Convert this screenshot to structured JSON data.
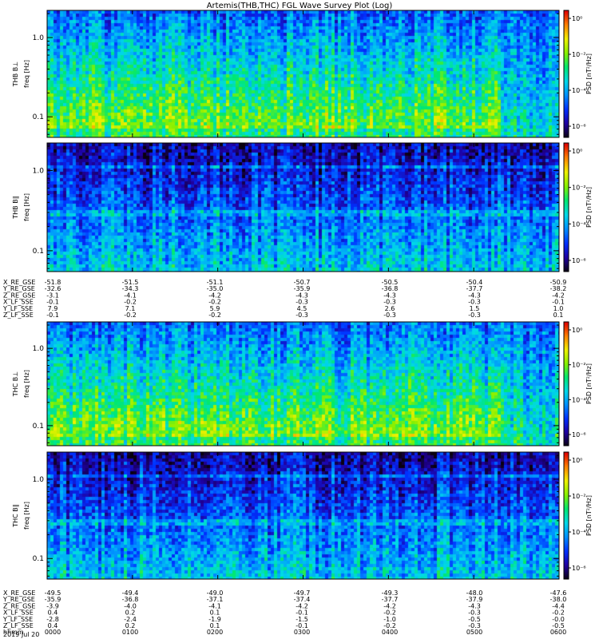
{
  "figure": {
    "title": "Artemis(THB,THC) FGL Wave Survey Plot (Log)",
    "colorscale": [
      "#0a0010",
      "#2000a0",
      "#0030ff",
      "#0090ff",
      "#00d8e8",
      "#00e870",
      "#88f000",
      "#f0f000",
      "#ff8000",
      "#e00000"
    ],
    "colorbar_label": "PSD [nT²/Hz]",
    "colorbar_ticks": [
      "10⁰",
      "10⁻²",
      "10⁻⁴",
      "10⁻⁶"
    ]
  },
  "chart_data": [
    {
      "type": "heatmap",
      "panel_id": "thb-bperp",
      "ylabel": "THB B⊥",
      "ysublabel": "freq [Hz]",
      "yticks": [
        "1.0",
        "0.1"
      ],
      "ylim": [
        0.055,
        2.2
      ],
      "yscale": "log",
      "level": "high"
    },
    {
      "type": "heatmap",
      "panel_id": "thb-bpar",
      "ylabel": "THB B∥",
      "ysublabel": "freq [Hz]",
      "yticks": [
        "1.0",
        "0.1"
      ],
      "ylim": [
        0.055,
        2.2
      ],
      "yscale": "log",
      "level": "low"
    },
    {
      "type": "heatmap",
      "panel_id": "thc-bperp",
      "ylabel": "THC B⊥",
      "ysublabel": "freq [Hz]",
      "yticks": [
        "1.0",
        "0.1"
      ],
      "ylim": [
        0.055,
        2.2
      ],
      "yscale": "log",
      "level": "high"
    },
    {
      "type": "heatmap",
      "panel_id": "thc-bpar",
      "ylabel": "THC B∥",
      "ysublabel": "freq [Hz]",
      "yticks": [
        "1.0",
        "0.1"
      ],
      "ylim": [
        0.055,
        2.2
      ],
      "yscale": "log",
      "level": "low"
    }
  ],
  "ephem_thb": [
    {
      "label": "X_RE_GSE",
      "values": [
        "-51.8",
        "-51.5",
        "-51.1",
        "-50.7",
        "-50.5",
        "-50.4",
        "-50.9"
      ]
    },
    {
      "label": "Y_RE_GSE",
      "values": [
        "-32.6",
        "-34.3",
        "-35.0",
        "-35.9",
        "-36.8",
        "-37.7",
        "-38.2"
      ]
    },
    {
      "label": "Z_RE_GSE",
      "values": [
        "-3.1",
        "-4.1",
        "-4.2",
        "-4.3",
        "-4.3",
        "-4.3",
        "-4.2"
      ]
    },
    {
      "label": "X_LF_SSE",
      "values": [
        "-0.1",
        "-0.2",
        "-0.2",
        "-0.3",
        "-0.3",
        "-0.3",
        "-0.1"
      ]
    },
    {
      "label": "Y_LF_SSE",
      "values": [
        "7.9",
        "7.1",
        "5.9",
        "4.5",
        "2.6",
        "1.5",
        "1.0"
      ]
    },
    {
      "label": "Z_LF_SSE",
      "values": [
        "-0.1",
        "-0.2",
        "-0.2",
        "-0.3",
        "-0.3",
        "-0.3",
        "0.1"
      ]
    }
  ],
  "ephem_thc": [
    {
      "label": "X_RE_GSE",
      "values": [
        "-49.5",
        "-49.4",
        "-49.0",
        "-49.7",
        "-49.3",
        "-48.0",
        "-47.6"
      ]
    },
    {
      "label": "Y_RE_GSE",
      "values": [
        "-35.9",
        "-36.8",
        "-37.1",
        "-37.4",
        "-37.7",
        "-37.9",
        "-38.0"
      ]
    },
    {
      "label": "Z_RE_GSE",
      "values": [
        "-3.9",
        "-4.0",
        "-4.1",
        "-4.2",
        "-4.2",
        "-4.3",
        "-4.4"
      ]
    },
    {
      "label": "X_LF_SSE",
      "values": [
        "0.4",
        "0.2",
        "0.1",
        "-0.1",
        "-0.2",
        "-0.3",
        "-0.2"
      ]
    },
    {
      "label": "Y_LF_SSE",
      "values": [
        "-2.8",
        "-2.4",
        "-1.9",
        "-1.5",
        "-1.0",
        "-0.5",
        "-0.0"
      ]
    },
    {
      "label": "Z_LF_SSE",
      "values": [
        "0.4",
        "0.2",
        "0.1",
        "-0.1",
        "-0.2",
        "-0.3",
        "-0.5"
      ]
    },
    {
      "label": "hhmm",
      "values": [
        "0000",
        "0100",
        "0200",
        "0300",
        "0400",
        "0500",
        "0600"
      ]
    }
  ],
  "date_label": "2019 Jul 20"
}
